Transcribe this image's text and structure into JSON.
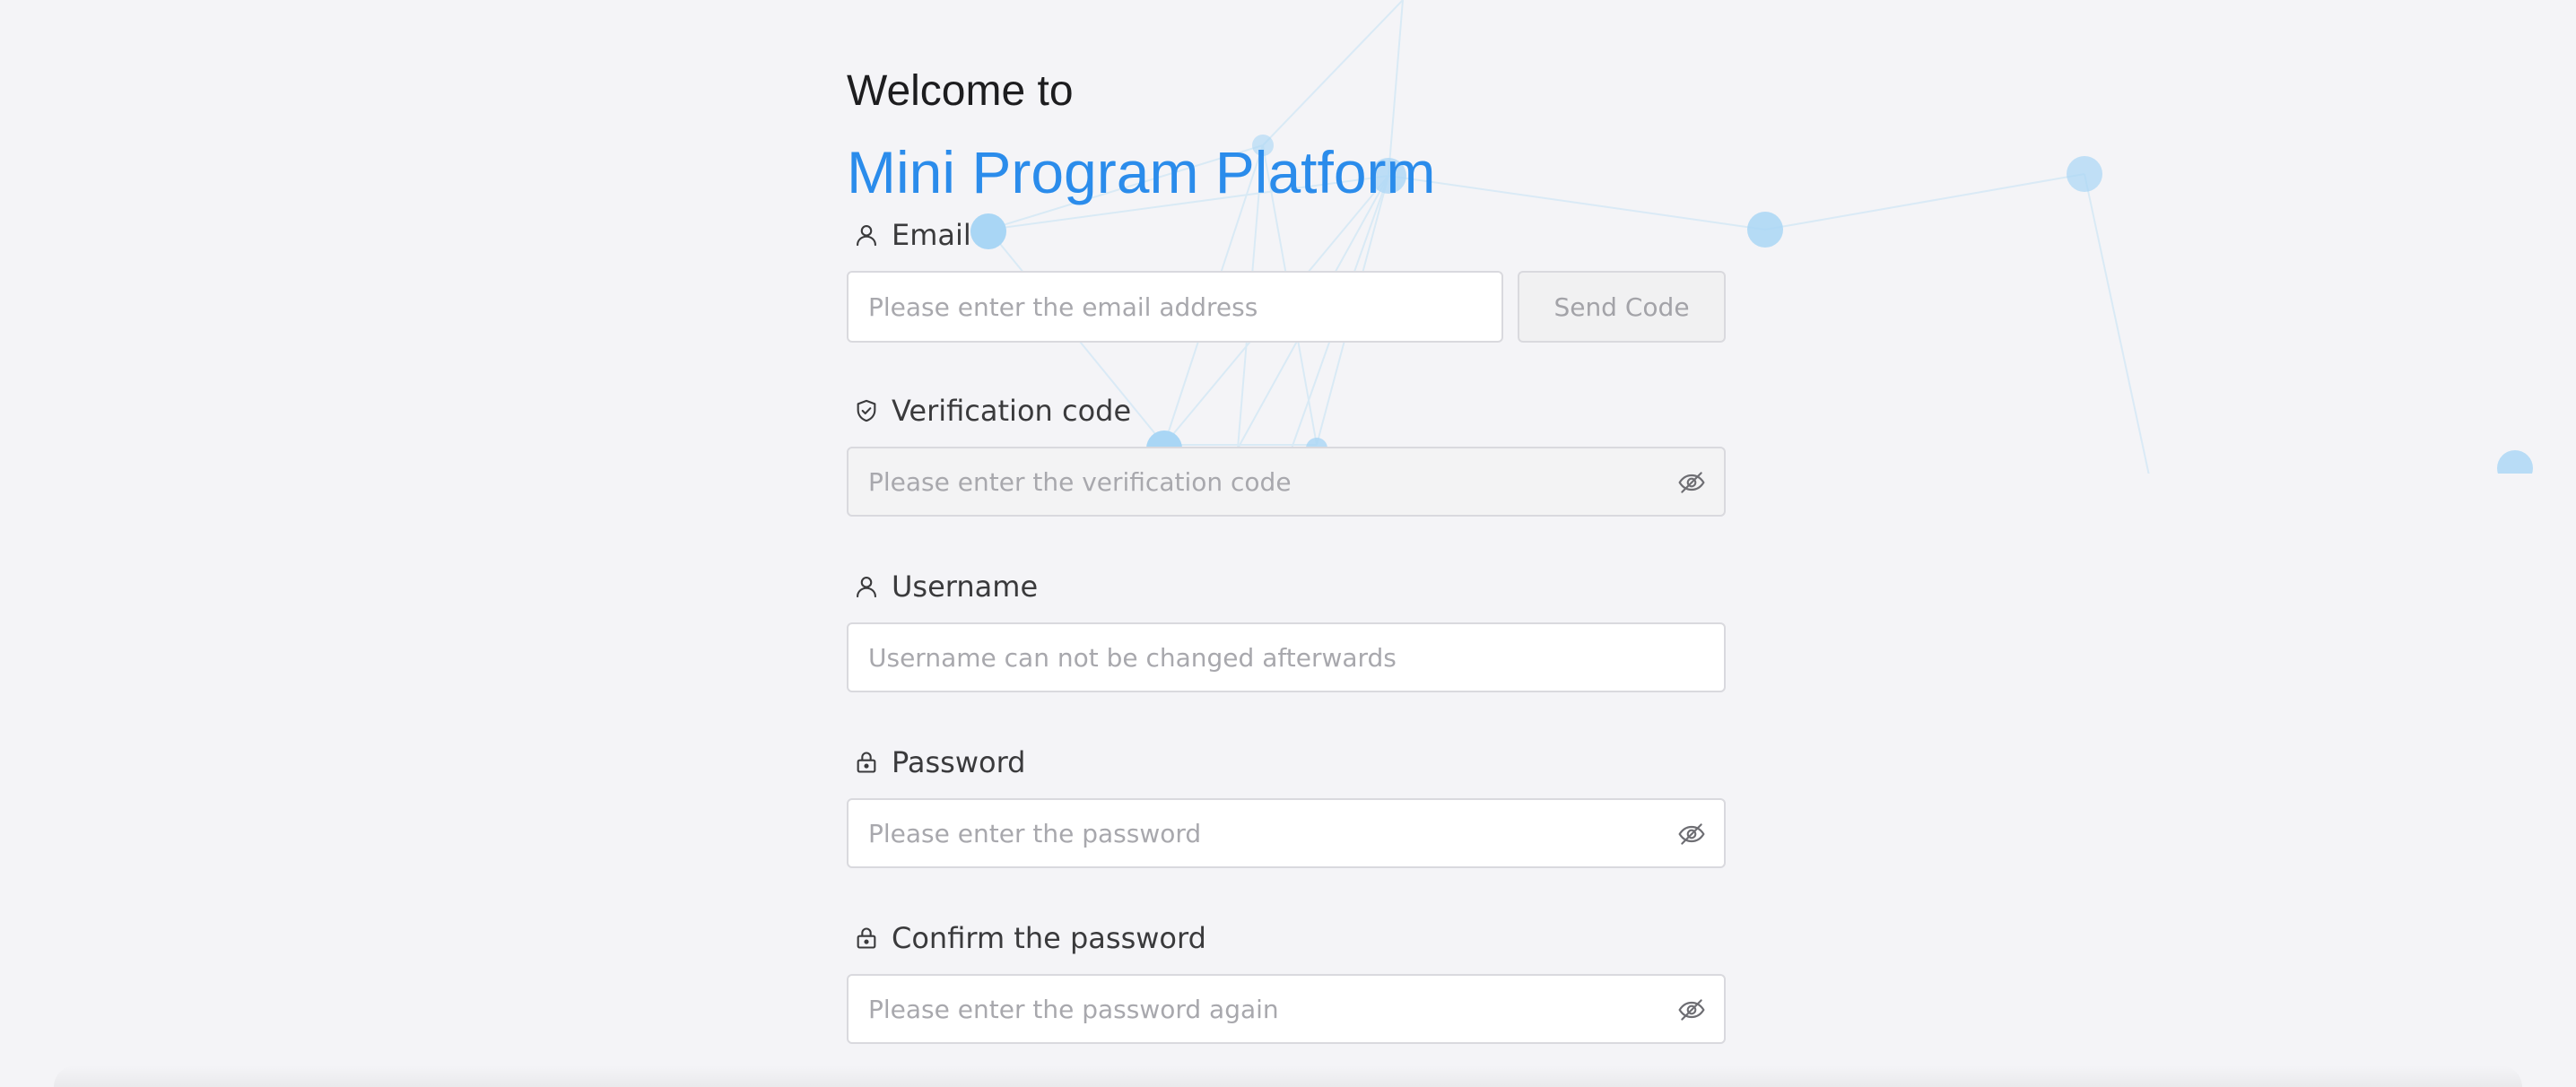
{
  "header": {
    "welcome": "Welcome to",
    "platform": "Mini Program Platform"
  },
  "colors": {
    "accent": "#2b8ceb",
    "background": "#f4f4f7",
    "node": "#a9d6f5"
  },
  "form": {
    "email": {
      "label": "Email",
      "icon": "user-icon",
      "placeholder": "Please enter the email address",
      "value": "",
      "send_code_label": "Send Code"
    },
    "verification": {
      "label": "Verification code",
      "icon": "shield-check-icon",
      "placeholder": "Please enter the verification code",
      "value": "",
      "toggle_icon": "eye-off-icon"
    },
    "username": {
      "label": "Username",
      "icon": "user-icon",
      "placeholder": "Username can not be changed afterwards",
      "value": ""
    },
    "password": {
      "label": "Password",
      "icon": "lock-icon",
      "placeholder": "Please enter the password",
      "value": "",
      "toggle_icon": "eye-off-icon"
    },
    "confirm_password": {
      "label": "Confirm the password",
      "icon": "lock-icon",
      "placeholder": "Please enter the password again",
      "value": "",
      "toggle_icon": "eye-off-icon"
    }
  }
}
